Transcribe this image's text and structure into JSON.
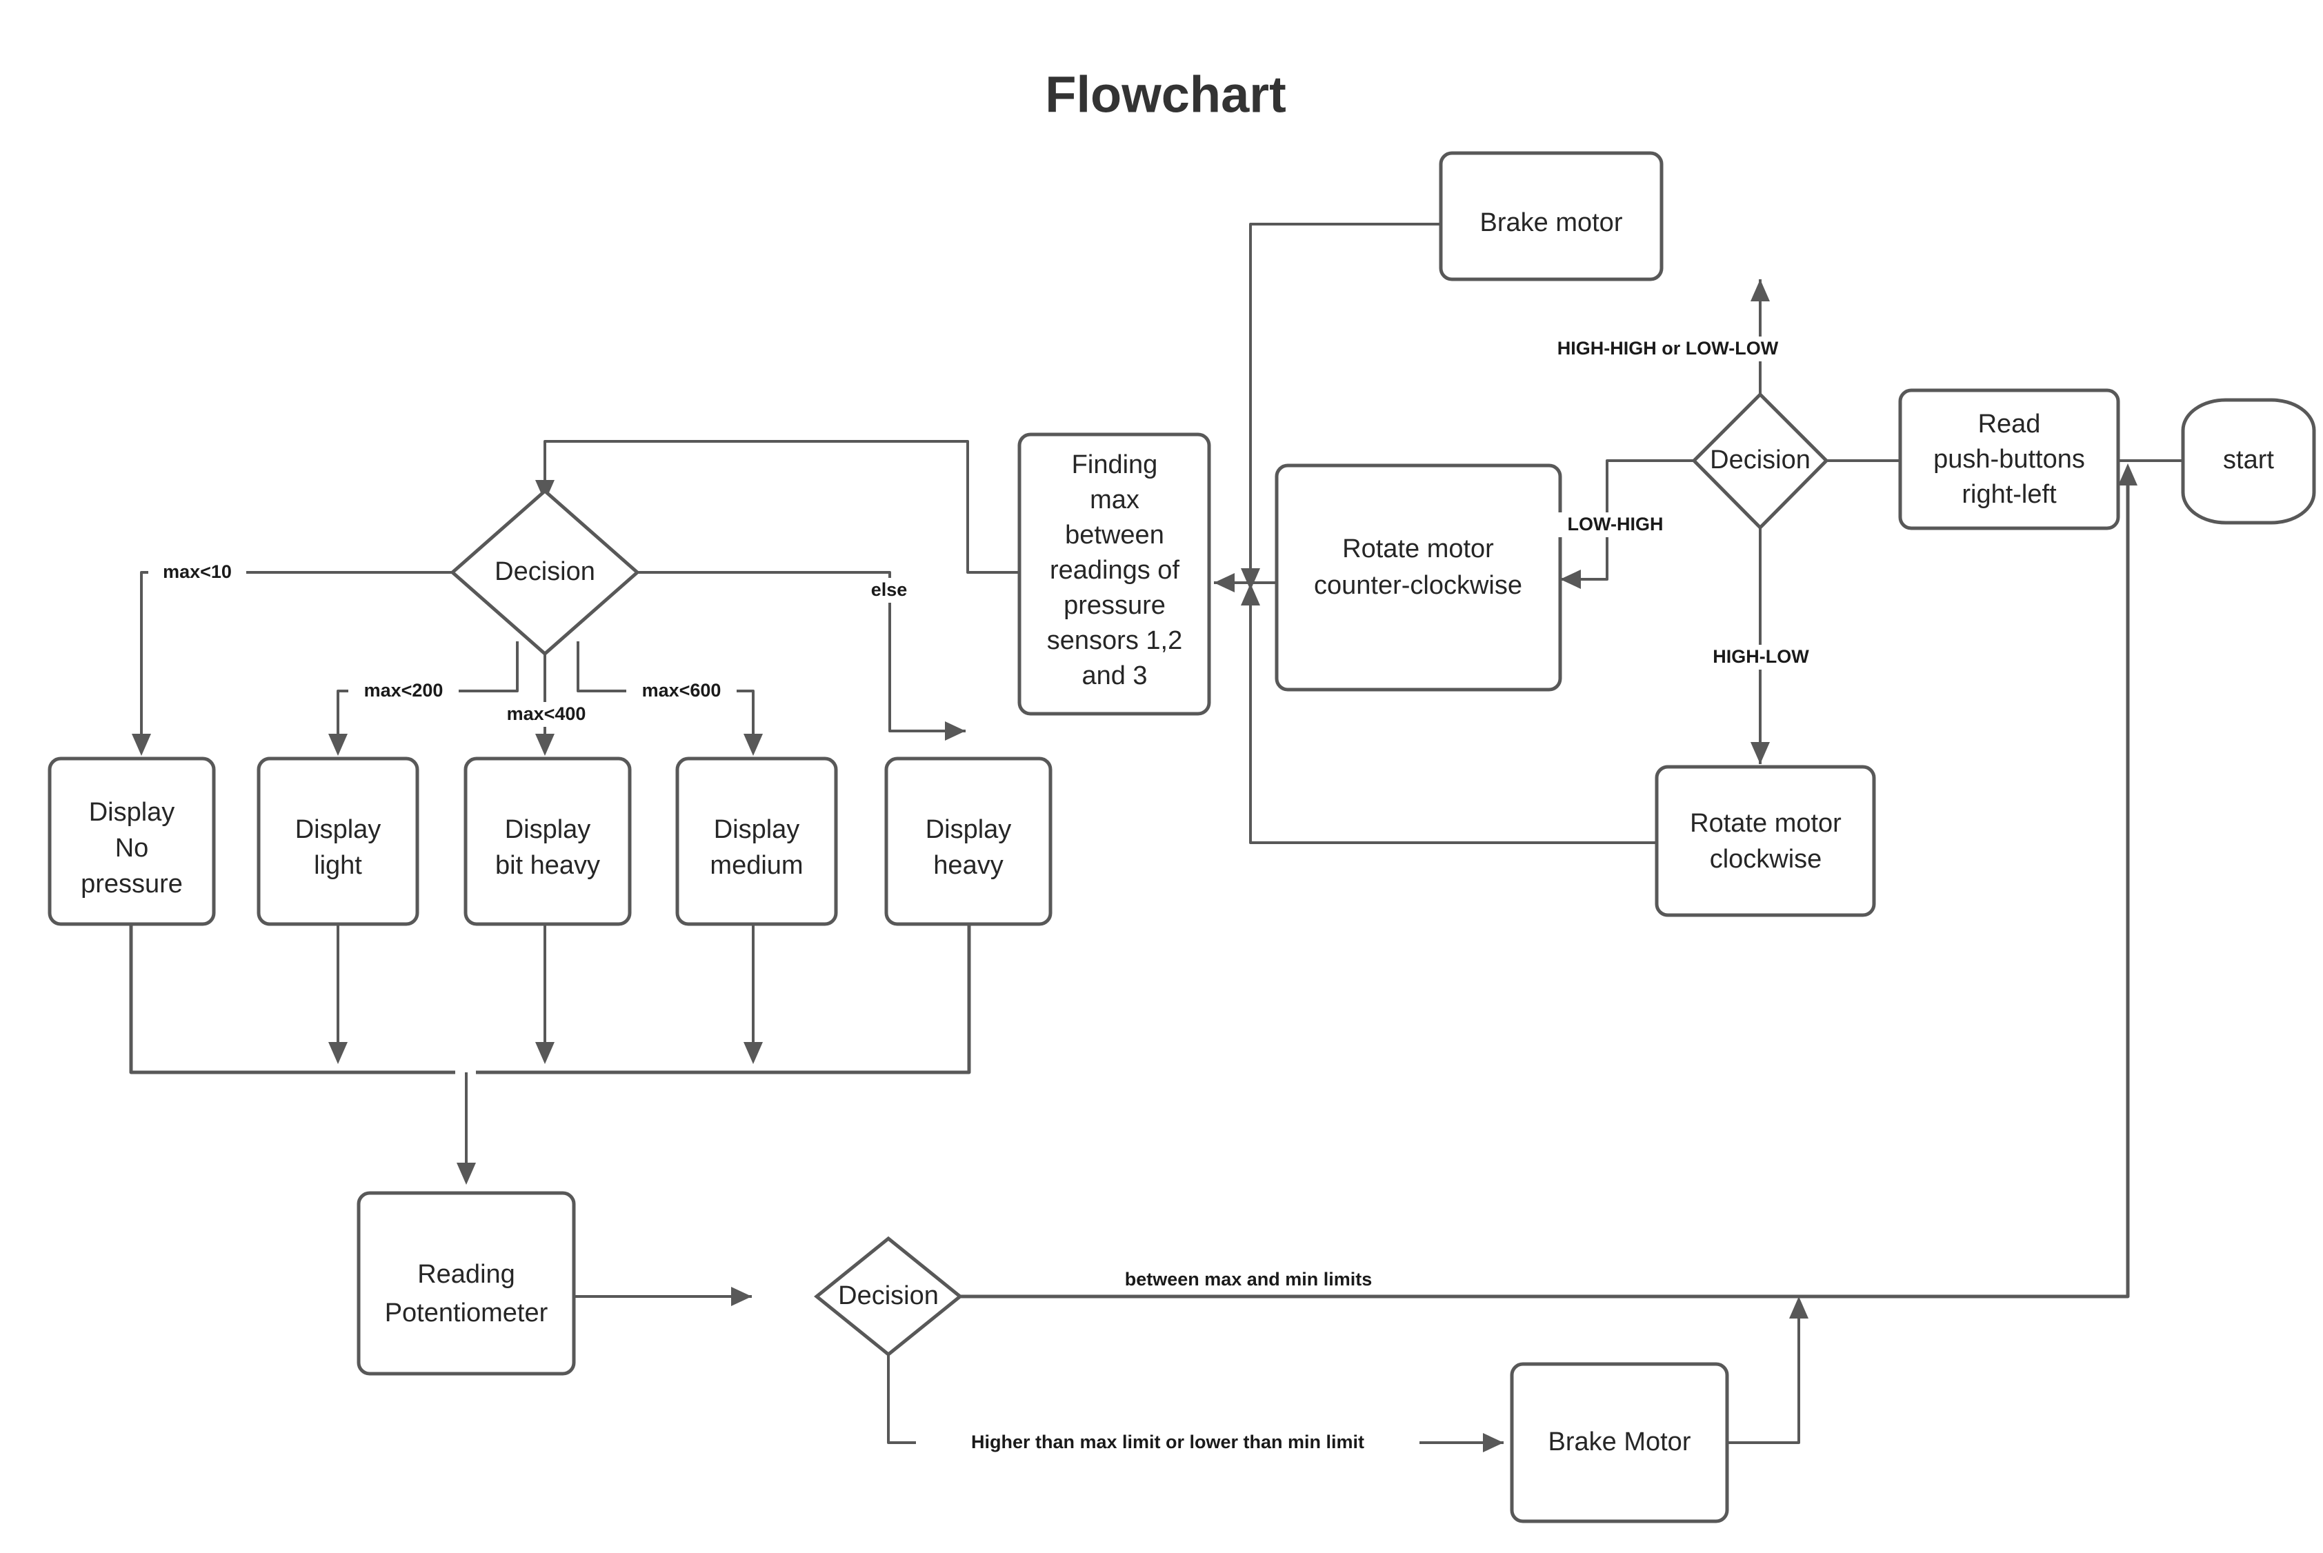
{
  "title": "Flowchart",
  "colors": {
    "stroke": "#585858",
    "node_text": "#262626",
    "label_text": "#1a1a1a",
    "title_text": "#333333",
    "background": "#ffffff"
  },
  "chart_data": {
    "type": "diagram",
    "diagram_kind": "flowchart",
    "title": "Flowchart",
    "nodes": [
      {
        "id": "start",
        "shape": "terminator",
        "label": "start",
        "lines": [
          "start"
        ]
      },
      {
        "id": "read_push_buttons",
        "shape": "process",
        "label": "Read push-buttons right-left",
        "lines": [
          "Read",
          "push-buttons",
          "right-left"
        ]
      },
      {
        "id": "decision_buttons",
        "shape": "decision",
        "label": "Decision",
        "lines": [
          "Decision"
        ]
      },
      {
        "id": "brake_motor_top",
        "shape": "process",
        "label": "Brake motor",
        "lines": [
          "Brake motor"
        ]
      },
      {
        "id": "rotate_ccw",
        "shape": "process",
        "label": "Rotate motor counter-clockwise",
        "lines": [
          "Rotate motor",
          "counter-clockwise"
        ]
      },
      {
        "id": "rotate_cw",
        "shape": "process",
        "label": "Rotate motor clockwise",
        "lines": [
          "Rotate motor",
          "clockwise"
        ]
      },
      {
        "id": "finding_max",
        "shape": "process",
        "label": "Finding max between readings of pressure sensors 1,2 and 3",
        "lines": [
          "Finding",
          "max",
          "between",
          "readings of",
          "pressure",
          "sensors 1,2",
          "and 3"
        ]
      },
      {
        "id": "decision_max",
        "shape": "decision",
        "label": "Decision",
        "lines": [
          "Decision"
        ]
      },
      {
        "id": "display_no_pressure",
        "shape": "process",
        "label": "Display No pressure",
        "lines": [
          "Display",
          "No",
          "pressure"
        ]
      },
      {
        "id": "display_light",
        "shape": "process",
        "label": "Display light",
        "lines": [
          "Display",
          "light"
        ]
      },
      {
        "id": "display_bit_heavy",
        "shape": "process",
        "label": "Display bit heavy",
        "lines": [
          "Display",
          "bit heavy"
        ]
      },
      {
        "id": "display_medium",
        "shape": "process",
        "label": "Display medium",
        "lines": [
          "Display",
          "medium"
        ]
      },
      {
        "id": "display_heavy",
        "shape": "process",
        "label": "Display heavy",
        "lines": [
          "Display",
          "heavy"
        ]
      },
      {
        "id": "reading_potentiometer",
        "shape": "process",
        "label": "Reading Potentiometer",
        "lines": [
          "Reading",
          "Potentiometer"
        ]
      },
      {
        "id": "decision_limits",
        "shape": "decision",
        "label": "Decision",
        "lines": [
          "Decision"
        ]
      },
      {
        "id": "brake_motor_bottom",
        "shape": "process",
        "label": "Brake Motor",
        "lines": [
          "Brake Motor"
        ]
      }
    ],
    "edges": [
      {
        "from": "start",
        "to": "read_push_buttons",
        "label": ""
      },
      {
        "from": "read_push_buttons",
        "to": "decision_buttons",
        "label": ""
      },
      {
        "from": "decision_buttons",
        "to": "brake_motor_top",
        "label": "HIGH-HIGH or LOW-LOW"
      },
      {
        "from": "decision_buttons",
        "to": "rotate_ccw",
        "label": "LOW-HIGH"
      },
      {
        "from": "decision_buttons",
        "to": "rotate_cw",
        "label": "HIGH-LOW"
      },
      {
        "from": "brake_motor_top",
        "to": "finding_max",
        "label": ""
      },
      {
        "from": "rotate_ccw",
        "to": "finding_max",
        "label": ""
      },
      {
        "from": "rotate_cw",
        "to": "finding_max",
        "label": ""
      },
      {
        "from": "finding_max",
        "to": "decision_max",
        "label": ""
      },
      {
        "from": "decision_max",
        "to": "display_no_pressure",
        "label": "max<10"
      },
      {
        "from": "decision_max",
        "to": "display_light",
        "label": "max<200"
      },
      {
        "from": "decision_max",
        "to": "display_bit_heavy",
        "label": "max<400"
      },
      {
        "from": "decision_max",
        "to": "display_medium",
        "label": "max<600"
      },
      {
        "from": "decision_max",
        "to": "display_heavy",
        "label": "else"
      },
      {
        "from": "display_no_pressure",
        "to": "reading_potentiometer",
        "label": ""
      },
      {
        "from": "display_light",
        "to": "reading_potentiometer",
        "label": ""
      },
      {
        "from": "display_bit_heavy",
        "to": "reading_potentiometer",
        "label": ""
      },
      {
        "from": "display_medium",
        "to": "reading_potentiometer",
        "label": ""
      },
      {
        "from": "display_heavy",
        "to": "reading_potentiometer",
        "label": ""
      },
      {
        "from": "reading_potentiometer",
        "to": "decision_limits",
        "label": ""
      },
      {
        "from": "decision_limits",
        "to": "read_push_buttons",
        "label": "between max and min limits"
      },
      {
        "from": "decision_limits",
        "to": "brake_motor_bottom",
        "label": "Higher than max limit or lower than min limit"
      },
      {
        "from": "brake_motor_bottom",
        "to": "read_push_buttons",
        "label": ""
      }
    ]
  },
  "labels": {
    "high_high_or_low_low": "HIGH-HIGH or LOW-LOW",
    "low_high": "LOW-HIGH",
    "high_low": "HIGH-LOW",
    "max_lt_10": "max<10",
    "max_lt_200": "max<200",
    "max_lt_400": "max<400",
    "max_lt_600": "max<600",
    "else": "else",
    "between_limits": "between max and min limits",
    "outside_limits": "Higher than max limit or lower than min limit"
  },
  "nodes": {
    "start": {
      "l1": "start"
    },
    "read_push_buttons": {
      "l1": "Read",
      "l2": "push-buttons",
      "l3": "right-left"
    },
    "decision_buttons": {
      "l1": "Decision"
    },
    "brake_motor_top": {
      "l1": "Brake motor"
    },
    "rotate_ccw": {
      "l1": "Rotate motor",
      "l2": "counter-clockwise"
    },
    "rotate_cw": {
      "l1": "Rotate motor",
      "l2": "clockwise"
    },
    "finding_max": {
      "l1": "Finding",
      "l2": "max",
      "l3": "between",
      "l4": "readings of",
      "l5": "pressure",
      "l6": "sensors 1,2",
      "l7": "and 3"
    },
    "decision_max": {
      "l1": "Decision"
    },
    "display_no_pressure": {
      "l1": "Display",
      "l2": "No",
      "l3": "pressure"
    },
    "display_light": {
      "l1": "Display",
      "l2": "light"
    },
    "display_bit_heavy": {
      "l1": "Display",
      "l2": "bit heavy"
    },
    "display_medium": {
      "l1": "Display",
      "l2": "medium"
    },
    "display_heavy": {
      "l1": "Display",
      "l2": "heavy"
    },
    "reading_potentiometer": {
      "l1": "Reading",
      "l2": "Potentiometer"
    },
    "decision_limits": {
      "l1": "Decision"
    },
    "brake_motor_bottom": {
      "l1": "Brake Motor"
    }
  }
}
